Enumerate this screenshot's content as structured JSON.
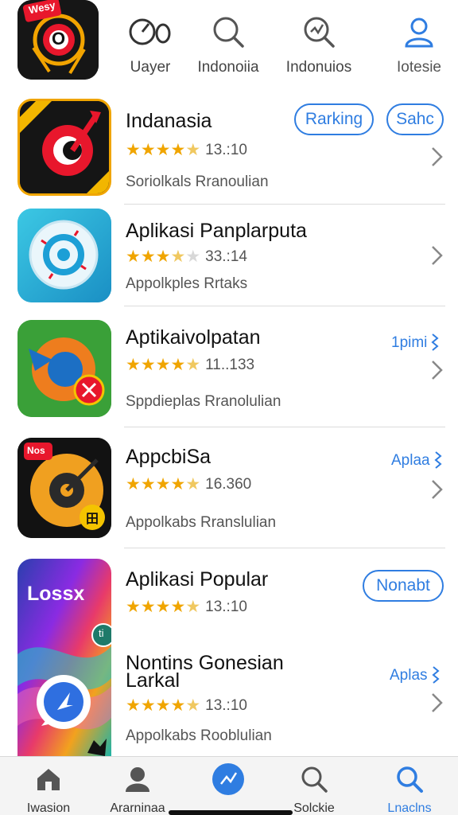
{
  "header": {
    "nav": [
      {
        "label": "Uayer",
        "icon": "player-icon"
      },
      {
        "label": "Indonoiia",
        "icon": "search-icon"
      },
      {
        "label": "Indonuios",
        "icon": "search-chart-icon"
      },
      {
        "label": "Iotesie",
        "icon": "profile-icon"
      }
    ]
  },
  "apps": [
    {
      "name": "Indanasia",
      "rating_text": "13.:10",
      "stars": 4.5,
      "subtitle": "Soriolkals Rranoulian",
      "buttons": [
        "Rarking",
        "Sahc"
      ]
    },
    {
      "name": "Aplikasi Panplarputa",
      "rating_text": "33.:14",
      "stars": 3.5,
      "subtitle": "Appolkples Rrtaks"
    },
    {
      "name": "Aptikaivolpatan",
      "rating_text": "11..133",
      "stars": 4.5,
      "subtitle": "Sppdieplas Rranolulian",
      "link": "1pimi"
    },
    {
      "name": "AppcbiSa",
      "rating_text": "16.360",
      "stars": 4.5,
      "subtitle": "Appolkabs Rranslulian",
      "link": "Aplaa"
    },
    {
      "name": "Aplikasi Popular",
      "rating_text": "13.:10",
      "stars": 4.5,
      "button": "Nonabt"
    },
    {
      "name_line1": "Nontins Gonesian",
      "name_line2": "Larkal",
      "rating_text": "13.:10",
      "stars": 4.5,
      "subtitle": "Appolkabs Rooblulian",
      "link": "Aplas"
    }
  ],
  "app_icon_texts": {
    "top_badge": "Wesy",
    "top_letter": "O",
    "icon4_badge": "Nos",
    "icon4_mark": "田",
    "icon5_logo": "Lossx",
    "icon5_badge": "ti"
  },
  "tabs": [
    {
      "label": "Iwasion",
      "icon": "home-icon"
    },
    {
      "label": "Ararninaa",
      "icon": "person-icon"
    },
    {
      "label": "",
      "icon": "compass-icon"
    },
    {
      "label": "Solckie",
      "icon": "search-icon"
    },
    {
      "label": "Lnaclns",
      "icon": "search-icon"
    }
  ],
  "colors": {
    "accent": "#2f7de1",
    "star": "#f0a500",
    "divider": "#dcdcdc",
    "tab_bar": "#f4f4f4"
  }
}
